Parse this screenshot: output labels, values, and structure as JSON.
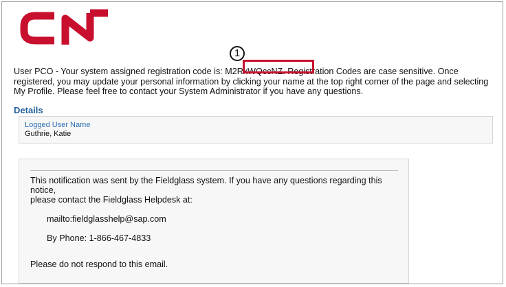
{
  "brand": {
    "logo_text": "CN",
    "logo_color": "#c8102e"
  },
  "email": {
    "intro_before_code": "User PCO - Your system assigned registration code is: ",
    "registration_code": "M2RxWQccNZ.",
    "intro_after_code": " Registration Codes are case sensitive. Once registered, you may update your personal information by clicking your name at the top right corner of the page and selecting My Profile. Please feel free to contact your System Administrator if you have any questions.",
    "callout_number": "1",
    "details": {
      "heading": "Details",
      "label": "Logged User Name",
      "value": "Guthrie, Katie"
    },
    "notice": {
      "line1": "This notification was sent by the Fieldglass system. If you have any questions regarding this notice,",
      "line2": "please contact the Fieldglass Helpdesk at:",
      "mailto": "mailto:fieldglasshelp@sap.com",
      "phone": "By Phone: 1-866-467-4833",
      "closing": "Please do not respond to this email."
    }
  },
  "colors": {
    "highlight": "#c8102e",
    "heading_blue": "#1f5d9b",
    "label_blue": "#2a6fb6"
  }
}
